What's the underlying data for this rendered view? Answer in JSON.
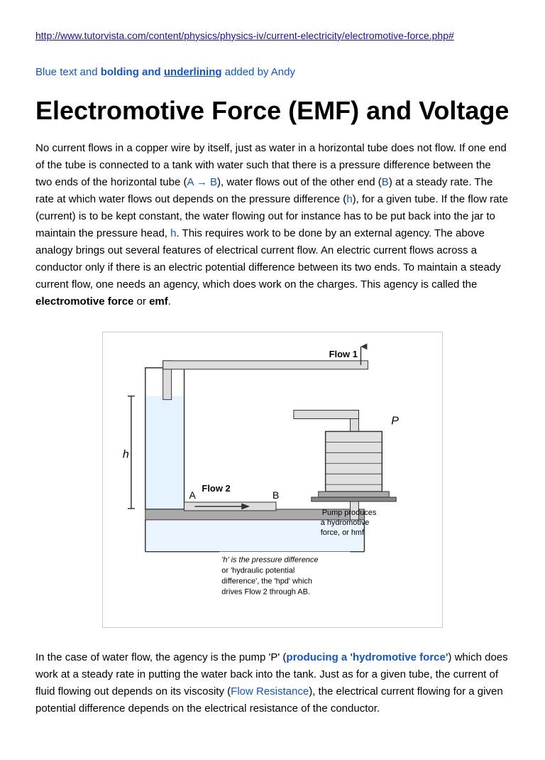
{
  "url": {
    "href": "http://www.tutorvista.com/content/physics/physics-iv/current-electricity/electromotive-force.php#",
    "display": "http://www.tutorvista.com/content/physics/physics-iv/current-electricity/electromotive-force.php#"
  },
  "annotation": {
    "blue_part": "Blue text and",
    "bold_part": "bolding and",
    "underline_part": "underlining",
    "rest_part": "added by Andy"
  },
  "title": "Electromotive Force (EMF) and Voltage",
  "main_paragraph": "No current flows in a copper wire by itself, just as water in a horizontal tube does not flow. If one end of the tube is connected to a tank with water such that there is a pressure difference between the two ends of the horizontal tube (A → B), water flows out of the other end (B) at a steady rate. The rate at which water flows out depends on the pressure difference (h), for a given tube. If the flow rate (current) is to be kept constant, the water flowing out for instance has to be put back into the jar to maintain the pressure head, h. This requires work to be done by an external agency. The above analogy brings out several features of electrical current flow. An electric current flows across a conductor only if there is an electric potential difference between its two ends. To maintain a steady current flow, one needs an agency, which does work on the charges. This agency is called the electromotive force or emf.",
  "bottom_paragraph_parts": {
    "before_p": "In the case of water flow, the agency is the pump 'P' (",
    "producing": "producing a 'hydromotive force'",
    "after_producing": ") which does work at a steady rate in putting the water back into the tank. Just as for a given tube, the current of fluid flowing out depends on its viscosity (",
    "flow_resistance": "Flow Resistance",
    "after_flow": "), the electrical current flowing for a given potential difference depends on the electrical resistance of the conductor."
  },
  "diagram": {
    "caption_h": "'h' is the pressure difference or 'hydraulic potential difference', the 'hpd' which drives Flow 2 through AB.",
    "pump_caption": "Pump produces a hydromotive force, or  hmf",
    "flow1_label": "Flow 1",
    "flow2_label": "Flow 2",
    "label_a": "A",
    "label_b": "B",
    "label_h": "h",
    "label_p": "P"
  }
}
